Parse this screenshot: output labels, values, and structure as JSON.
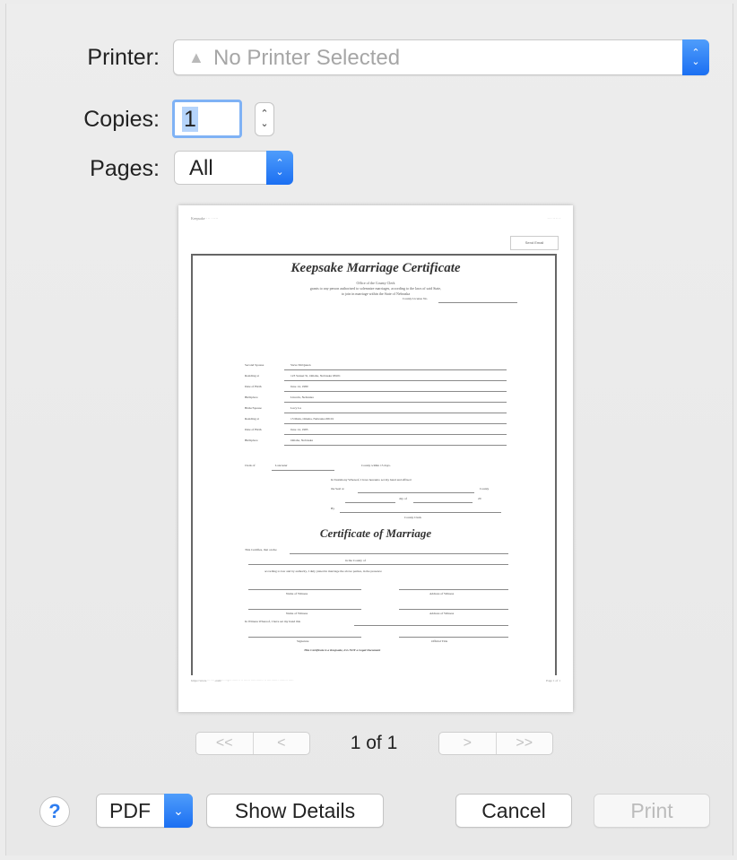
{
  "printer": {
    "label": "Printer:",
    "value": "No Printer Selected",
    "warning_icon": "warning-triangle-icon"
  },
  "copies": {
    "label": "Copies:",
    "value": "1"
  },
  "pages": {
    "label": "Pages:",
    "value": "All"
  },
  "preview": {
    "send_email": "Send Email",
    "title": "Keepsake Marriage Certificate",
    "subtitle1": "Office of the County Clerk",
    "subtitle2": "grants to any person authorized to solemnize marriages, according to the laws of said State,",
    "subtitle3": "to join in marriage within the State of Nebraska",
    "license": "County License No.",
    "fields": [
      {
        "label": "Second Spouse",
        "value": "Steve McQueen"
      },
      {
        "label": "Residing at",
        "value": "123 Sunset St, Omaha, Nebraska 68101"
      },
      {
        "label": "Date of Birth",
        "value": "June 14, 1980"
      },
      {
        "label": "Birthplace",
        "value": "Lincoln, Nebraska"
      },
      {
        "label": "Bride/Spouse",
        "value": "Lucy Lu"
      },
      {
        "label": "Residing at",
        "value": "13 Main, Omaha, Nebraska 68101"
      },
      {
        "label": "Date of Birth",
        "value": "June 14, 1985"
      },
      {
        "label": "Birthplace",
        "value": "Omaha, Nebraska"
      }
    ],
    "clerk_of": "Clerk of",
    "county": "Lancaster",
    "county_suffix": "County within 15 days.",
    "testimony": "In Testimony Whereof, I have hereunto set my hand and affixed",
    "seal_at": "the Seal at",
    "county_word": "County",
    "day_of": "day of",
    "year": "20",
    "by": "By",
    "county_clerk": "County Clerk",
    "cert_title": "Certificate of Marriage",
    "cert_line1": "This Certifies, that on the",
    "cert_line2": "in the County of",
    "cert_line3": "according to law and by authority, I duly joined in marriage the above parties, in the presence",
    "witness": "Name of Witness",
    "witness_addr": "Address of Witness",
    "in_witness": "In Witness Whereof, I have set my hand this",
    "signature": "Signature",
    "official_title": "Official Title",
    "keepsake_note": "This Certificate is a Keepsake, it is NOT a Legal Document"
  },
  "page_nav": {
    "first": "<<",
    "prev": "<",
    "count": "1 of 1",
    "next": ">",
    "last": ">>"
  },
  "buttons": {
    "help": "?",
    "pdf": "PDF",
    "show_details": "Show Details",
    "cancel": "Cancel",
    "print": "Print"
  }
}
